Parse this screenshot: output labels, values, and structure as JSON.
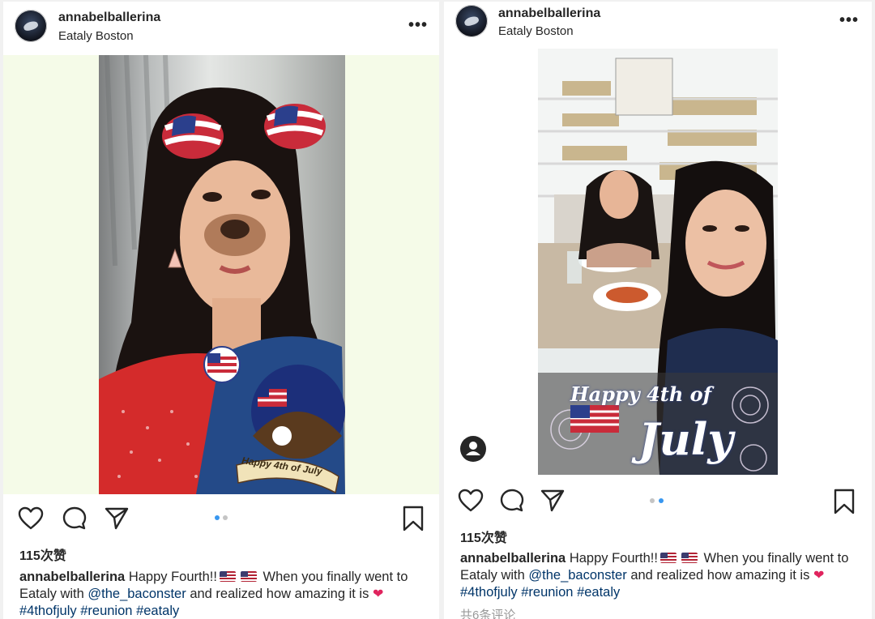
{
  "posts": [
    {
      "username": "annabelballerina",
      "location": "Eataly Boston",
      "more_label": "•••",
      "likes": "115次赞",
      "caption": {
        "username": "annabelballerina",
        "text_1": "Happy Fourth!!",
        "text_2": "When you finally went to Eataly with",
        "mention": "@the_baconster",
        "text_3": "and realized how amazing it is",
        "hashtags": [
          "#4thofjuly",
          "#reunion",
          "#eataly"
        ]
      },
      "photo": {
        "sticker_text": "Happy 4th of July"
      },
      "carousel": {
        "count": 2,
        "active_index": 0
      }
    },
    {
      "username": "annabelballerina",
      "location": "Eataly Boston",
      "more_label": "•••",
      "likes": "115次赞",
      "caption": {
        "username": "annabelballerina",
        "text_1": "Happy Fourth!!",
        "text_2": "When you finally went to Eataly with",
        "mention": "@the_baconster",
        "text_3": "and realized how amazing it is",
        "hashtags": [
          "#4thofjuly",
          "#reunion",
          "#eataly"
        ]
      },
      "comments_link": "共6条评论",
      "photo": {
        "sticker_line_1": "Happy 4th of",
        "sticker_line_2": "July"
      },
      "carousel": {
        "count": 2,
        "active_index": 1
      }
    }
  ],
  "colors": {
    "active_dot": "#3897f0",
    "inactive_dot": "#c4c4c4",
    "link": "#003569",
    "text": "#262626"
  },
  "icons": [
    "heart-icon",
    "comment-icon",
    "share-icon",
    "bookmark-icon",
    "user-tag-icon"
  ]
}
